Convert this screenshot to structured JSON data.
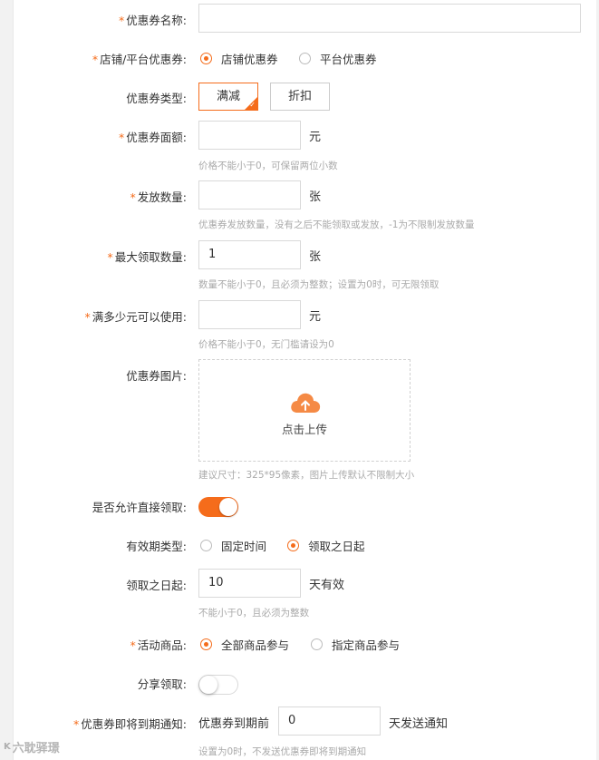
{
  "required_mark": "*",
  "fields": {
    "coupon_name": {
      "label": "优惠券名称:",
      "value": ""
    },
    "scope": {
      "label": "店铺/平台优惠券:",
      "options": [
        "店铺优惠券",
        "平台优惠券"
      ],
      "selected": "店铺优惠券"
    },
    "coupon_type": {
      "label": "优惠券类型:",
      "options": [
        "满减",
        "折扣"
      ],
      "selected": "满减"
    },
    "face_value": {
      "label": "优惠券面额:",
      "value": "",
      "unit": "元",
      "hint": "价格不能小于0，可保留两位小数"
    },
    "issue_qty": {
      "label": "发放数量:",
      "value": "",
      "unit": "张",
      "hint": "优惠券发放数量，没有之后不能领取或发放，-1为不限制发放数量"
    },
    "max_claim": {
      "label": "最大领取数量:",
      "value": "1",
      "unit": "张",
      "hint": "数量不能小于0，且必须为整数；设置为0时，可无限领取"
    },
    "min_spend": {
      "label": "满多少元可以使用:",
      "value": "",
      "unit": "元",
      "hint": "价格不能小于0，无门槛请设为0"
    },
    "image": {
      "label": "优惠券图片:",
      "upload_text": "点击上传",
      "hint": "建议尺寸：325*95像素，图片上传默认不限制大小"
    },
    "direct_claim": {
      "label": "是否允许直接领取:",
      "on": true
    },
    "validity_type": {
      "label": "有效期类型:",
      "options": [
        "固定时间",
        "领取之日起"
      ],
      "selected": "领取之日起"
    },
    "days_from_claim": {
      "label": "领取之日起:",
      "value": "10",
      "unit": "天有效",
      "hint": "不能小于0，且必须为整数"
    },
    "goods": {
      "label": "活动商品:",
      "options": [
        "全部商品参与",
        "指定商品参与"
      ],
      "selected": "全部商品参与"
    },
    "share_claim": {
      "label": "分享领取:",
      "on": false
    },
    "expiry_notice": {
      "label": "优惠券即将到期通知:",
      "prefix": "优惠券到期前",
      "value": "0",
      "suffix": "天发送通知",
      "hint": "设置为0时，不发送优惠券即将到期通知"
    }
  },
  "watermark": {
    "mark": "K",
    "text": "六耽驿璟"
  },
  "colors": {
    "accent": "#f56c1b",
    "required": "#f56c1b",
    "hint": "#aaaaaa"
  },
  "icons": {
    "upload": "cloud-upload-icon",
    "check": "check-icon"
  }
}
